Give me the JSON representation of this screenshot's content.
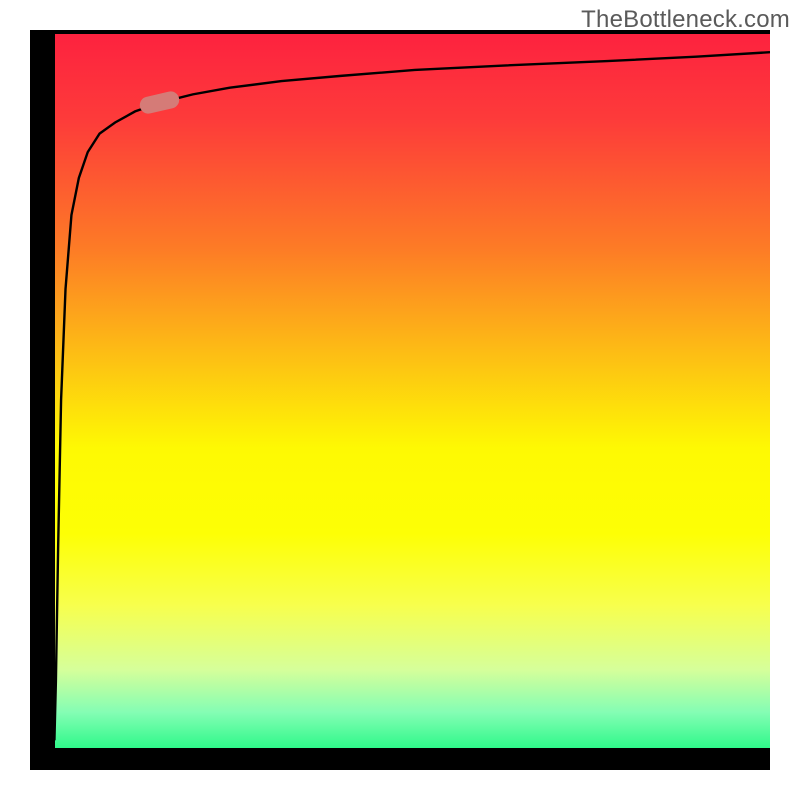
{
  "watermark": "TheBottleneck.com",
  "chart_data": {
    "type": "line",
    "title": "",
    "xlabel": "",
    "ylabel": "",
    "xlim": [
      0,
      100
    ],
    "ylim": [
      0,
      100
    ],
    "series": [
      {
        "name": "curve",
        "x": [
          2.0,
          3.3,
          3.5,
          3.8,
          4.2,
          4.8,
          5.6,
          6.6,
          7.8,
          9.4,
          11.5,
          14.2,
          18.0,
          22.0,
          27.0,
          34.0,
          42.0,
          52.0,
          64.0,
          78.0,
          90.0,
          100.0
        ],
        "values": [
          97,
          4,
          12,
          30,
          50,
          65,
          75,
          80,
          83.5,
          86,
          87.5,
          89,
          90.3,
          91.3,
          92.2,
          93.1,
          93.8,
          94.6,
          95.2,
          95.8,
          96.4,
          97
        ]
      }
    ],
    "marker": {
      "x": 17.5,
      "y": 90.2,
      "angle_deg": -13
    },
    "gradient_colors": [
      "#fd223f",
      "#fd7b26",
      "#fef903",
      "#2ff98a"
    ],
    "grid": false
  }
}
